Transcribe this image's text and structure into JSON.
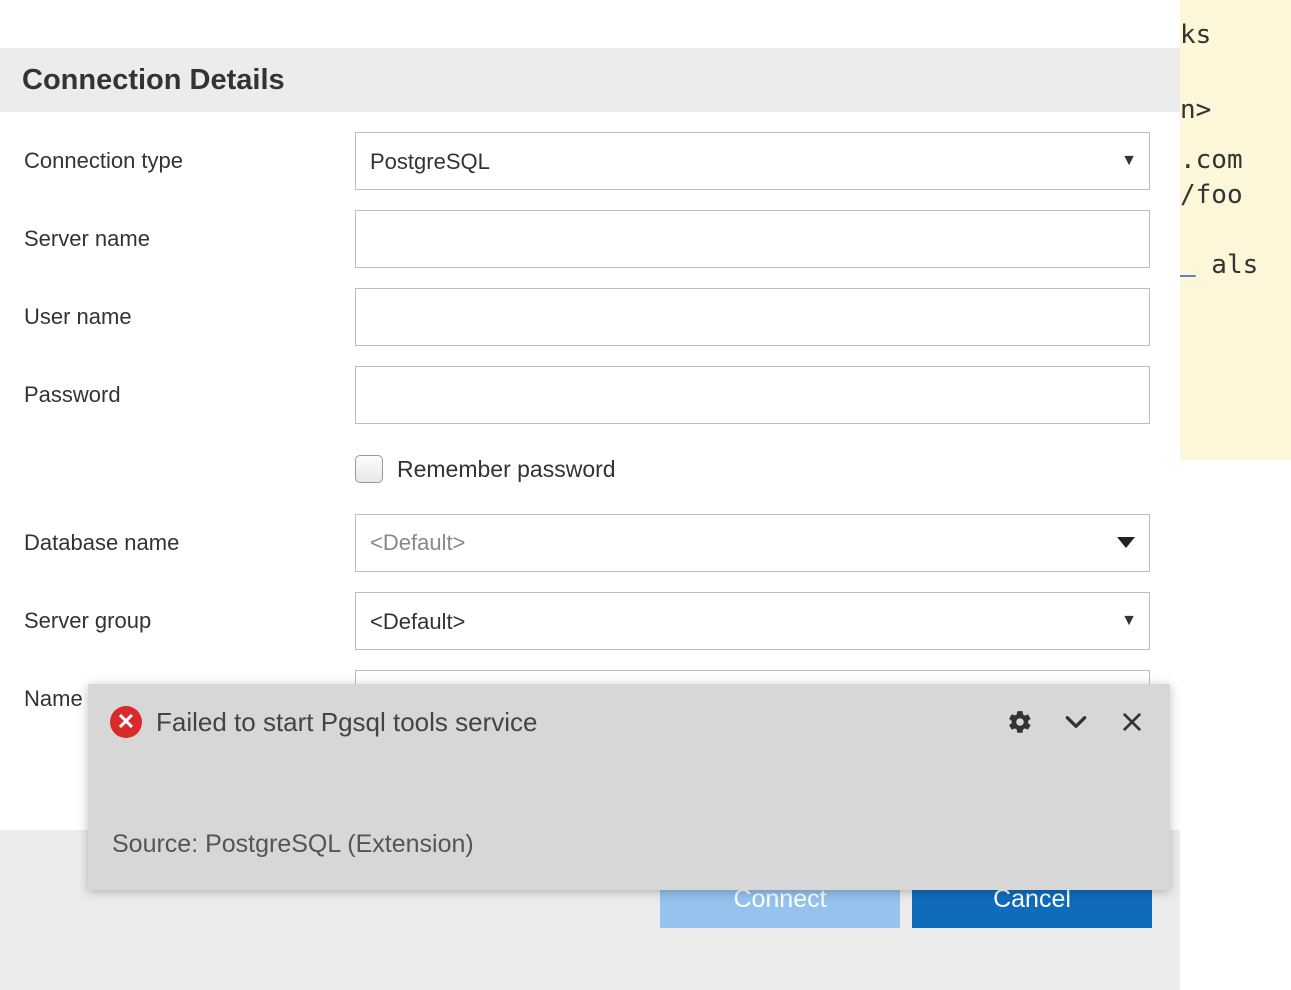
{
  "section": {
    "title": "Connection Details"
  },
  "form": {
    "connection_type": {
      "label": "Connection type",
      "value": "PostgreSQL"
    },
    "server_name": {
      "label": "Server name",
      "value": ""
    },
    "user_name": {
      "label": "User name",
      "value": ""
    },
    "password": {
      "label": "Password",
      "value": ""
    },
    "remember": {
      "label": "Remember password",
      "checked": false
    },
    "database_name": {
      "label": "Database name",
      "value": "<Default>"
    },
    "server_group": {
      "label": "Server group",
      "value": "<Default>"
    },
    "name_optional": {
      "label": "Name",
      "value": ""
    }
  },
  "buttons": {
    "connect": "Connect",
    "cancel": "Cancel"
  },
  "toast": {
    "message": "Failed to start Pgsql tools service",
    "source": "Source: PostgreSQL (Extension)"
  },
  "bg": {
    "l1": "ks",
    "l2": "n>",
    "l3": ".com",
    "l4": "/foo",
    "l5c": " als"
  }
}
